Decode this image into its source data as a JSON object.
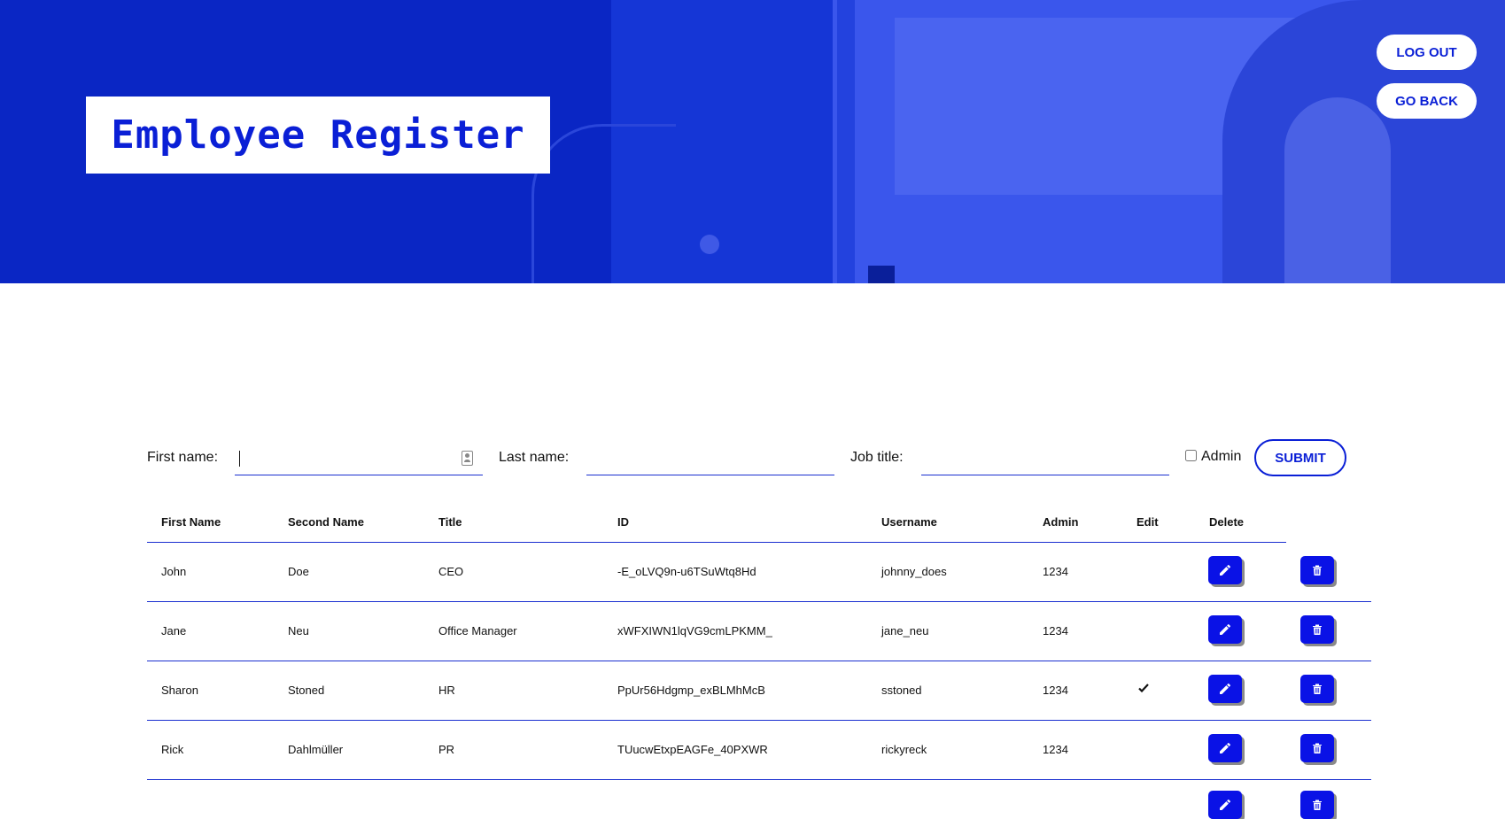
{
  "header": {
    "title": "Employee Register",
    "logout_label": "LOG OUT",
    "goback_label": "GO BACK"
  },
  "form": {
    "first_name_label": "First name:",
    "last_name_label": "Last name:",
    "job_title_label": "Job title:",
    "admin_label": "Admin",
    "submit_label": "SUBMIT",
    "first_name_value": "",
    "last_name_value": "",
    "job_title_value": ""
  },
  "table": {
    "headers": [
      "First Name",
      "Second Name",
      "Title",
      "ID",
      "Username",
      "Admin",
      "Edit",
      "Delete"
    ],
    "rows": [
      {
        "first": "John",
        "second": "Doe",
        "title": "CEO",
        "id": "-E_oLVQ9n-u6TSuWtq8Hd",
        "username": "johnny_does",
        "admin": "1234",
        "edit_check": false
      },
      {
        "first": "Jane",
        "second": "Neu",
        "title": "Office Manager",
        "id": "xWFXIWN1lqVG9cmLPKMM_",
        "username": "jane_neu",
        "admin": "1234",
        "edit_check": false
      },
      {
        "first": "Sharon",
        "second": "Stoned",
        "title": "HR",
        "id": "PpUr56Hdgmp_exBLMhMcB",
        "username": "sstoned",
        "admin": "1234",
        "edit_check": true
      },
      {
        "first": "Rick",
        "second": "Dahlmüller",
        "title": "PR",
        "id": "TUucwEtxpEAGFe_40PXWR",
        "username": "rickyreck",
        "admin": "1234",
        "edit_check": false
      }
    ]
  },
  "icons": {
    "edit": "pencil-icon",
    "delete": "trash-icon",
    "check": "checkmark-icon",
    "contact": "contact-card-icon"
  },
  "colors": {
    "brand_blue": "#0a1fd6",
    "button_blue": "#0a12e6",
    "hero_blue": "#0b2ad1"
  }
}
